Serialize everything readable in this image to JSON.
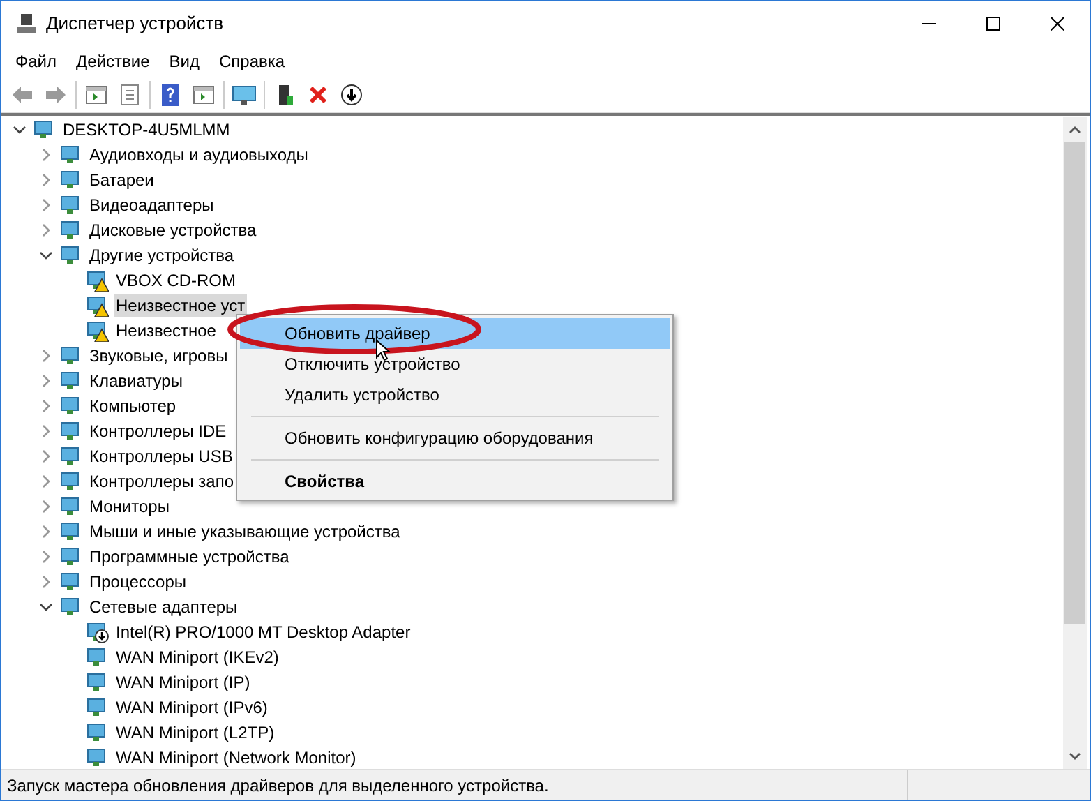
{
  "window": {
    "title": "Диспетчер устройств"
  },
  "menu": [
    "Файл",
    "Действие",
    "Вид",
    "Справка"
  ],
  "tree": {
    "label": "DESKTOP-4U5MLMM",
    "expanded": true,
    "selected": false,
    "kind": "device",
    "children": [
      {
        "label": "Аудиовходы и аудиовыходы",
        "expanded": false,
        "selected": false,
        "kind": "device"
      },
      {
        "label": "Батареи",
        "expanded": false,
        "selected": false,
        "kind": "device"
      },
      {
        "label": "Видеоадаптеры",
        "expanded": false,
        "selected": false,
        "kind": "device"
      },
      {
        "label": "Дисковые устройства",
        "expanded": false,
        "selected": false,
        "kind": "device"
      },
      {
        "label": "Другие устройства",
        "expanded": true,
        "selected": false,
        "kind": "device",
        "children": [
          {
            "label": "VBOX CD-ROM",
            "selected": false,
            "kind": "warning"
          },
          {
            "label": "Неизвестное уст",
            "selected": true,
            "kind": "warning"
          },
          {
            "label": "Неизвестное",
            "selected": false,
            "kind": "warning"
          }
        ]
      },
      {
        "label": "Звуковые, игровы",
        "expanded": false,
        "selected": false,
        "kind": "device"
      },
      {
        "label": "Клавиатуры",
        "expanded": false,
        "selected": false,
        "kind": "device"
      },
      {
        "label": "Компьютер",
        "expanded": false,
        "selected": false,
        "kind": "device"
      },
      {
        "label": "Контроллеры IDE",
        "expanded": false,
        "selected": false,
        "kind": "device"
      },
      {
        "label": "Контроллеры USB",
        "expanded": false,
        "selected": false,
        "kind": "device"
      },
      {
        "label": "Контроллеры запо",
        "expanded": false,
        "selected": false,
        "kind": "device"
      },
      {
        "label": "Мониторы",
        "expanded": false,
        "selected": false,
        "kind": "device"
      },
      {
        "label": "Мыши и иные указывающие устройства",
        "expanded": false,
        "selected": false,
        "kind": "device"
      },
      {
        "label": "Программные устройства",
        "expanded": false,
        "selected": false,
        "kind": "device"
      },
      {
        "label": "Процессоры",
        "expanded": false,
        "selected": false,
        "kind": "device"
      },
      {
        "label": "Сетевые адаптеры",
        "expanded": true,
        "selected": false,
        "kind": "device",
        "children": [
          {
            "label": "Intel(R) PRO/1000 MT Desktop Adapter",
            "selected": false,
            "kind": "disabled"
          },
          {
            "label": "WAN Miniport (IKEv2)",
            "selected": false,
            "kind": "device"
          },
          {
            "label": "WAN Miniport (IP)",
            "selected": false,
            "kind": "device"
          },
          {
            "label": "WAN Miniport (IPv6)",
            "selected": false,
            "kind": "device"
          },
          {
            "label": "WAN Miniport (L2TP)",
            "selected": false,
            "kind": "device"
          },
          {
            "label": "WAN Miniport (Network Monitor)",
            "selected": false,
            "kind": "device"
          }
        ]
      }
    ]
  },
  "context_menu": [
    {
      "kind": "item",
      "label": "Обновить драйвер",
      "selected": true,
      "bold": false
    },
    {
      "kind": "item",
      "label": "Отключить устройство",
      "selected": false,
      "bold": false
    },
    {
      "kind": "item",
      "label": "Удалить устройство",
      "selected": false,
      "bold": false
    },
    {
      "kind": "separator"
    },
    {
      "kind": "item",
      "label": "Обновить конфигурацию оборудования",
      "selected": false,
      "bold": false
    },
    {
      "kind": "separator"
    },
    {
      "kind": "item",
      "label": "Свойства",
      "selected": false,
      "bold": true
    }
  ],
  "status_bar": "Запуск мастера обновления драйверов для выделенного устройства."
}
